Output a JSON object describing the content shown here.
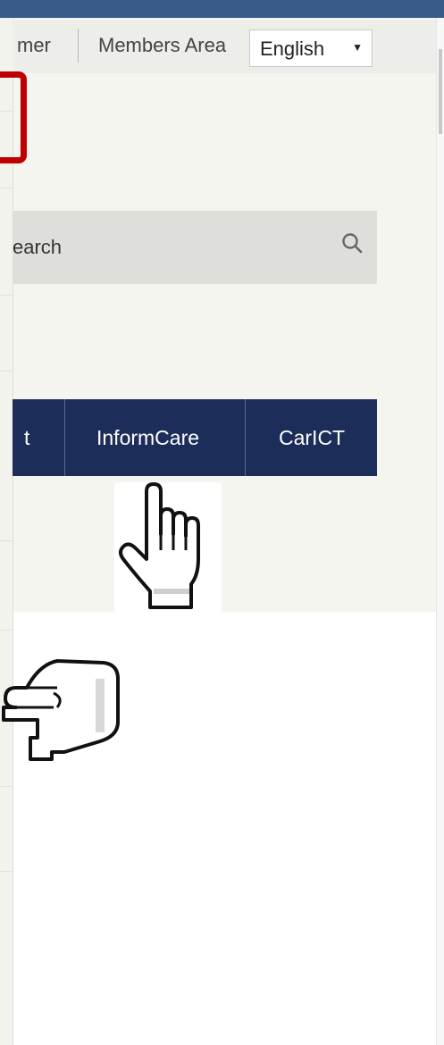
{
  "header": {
    "partial_link": "mer",
    "members_area": "Members Area",
    "language": "English"
  },
  "search": {
    "placeholder_partial": "earch"
  },
  "nav": {
    "items": [
      {
        "label": "t"
      },
      {
        "label": "InformCare"
      },
      {
        "label": "CarICT"
      }
    ]
  },
  "icons": {
    "search": "search-icon",
    "pointer_cursor": "hand-pointer-icon",
    "pointing_hand": "hand-point-right-icon",
    "select_arrow": "dropdown-arrow-icon"
  },
  "colors": {
    "top_bar": "#3a5a8a",
    "nav_bar": "#1d2d5a",
    "highlight": "#c00000",
    "search_bg": "#dededb"
  }
}
